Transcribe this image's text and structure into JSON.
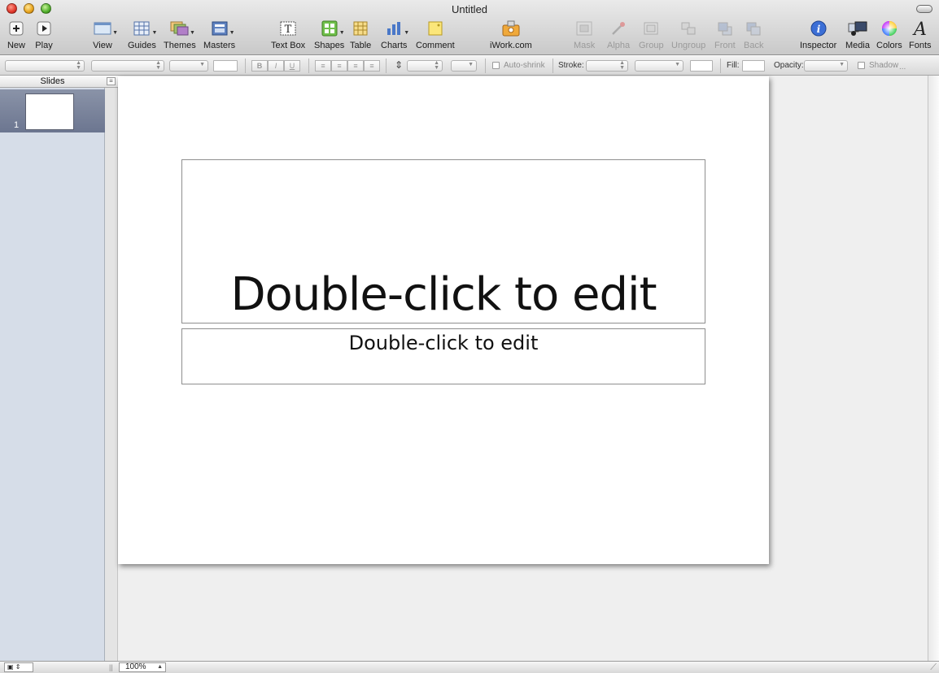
{
  "window": {
    "title": "Untitled"
  },
  "toolbar": {
    "new": "New",
    "play": "Play",
    "view": "View",
    "guides": "Guides",
    "themes": "Themes",
    "masters": "Masters",
    "text_box": "Text Box",
    "shapes": "Shapes",
    "table": "Table",
    "charts": "Charts",
    "comment": "Comment",
    "iwork": "iWork.com",
    "mask": "Mask",
    "alpha": "Alpha",
    "group": "Group",
    "ungroup": "Ungroup",
    "front": "Front",
    "back": "Back",
    "inspector": "Inspector",
    "media": "Media",
    "colors": "Colors",
    "fonts": "Fonts"
  },
  "format_bar": {
    "bold": "B",
    "italic": "I",
    "underline": "U",
    "auto_shrink": "Auto-shrink",
    "stroke_label": "Stroke:",
    "fill_label": "Fill:",
    "opacity_label": "Opacity:",
    "shadow": "Shadow",
    "overflow": "..."
  },
  "slides_panel": {
    "header": "Slides",
    "slides": [
      {
        "number": "1"
      }
    ]
  },
  "slide": {
    "title_placeholder": "Double-click to edit",
    "subtitle_placeholder": "Double-click to edit"
  },
  "status": {
    "zoom": "100%"
  },
  "colors": {
    "selected_slide": "#6c7690",
    "panel_bg": "#d6dde8"
  }
}
